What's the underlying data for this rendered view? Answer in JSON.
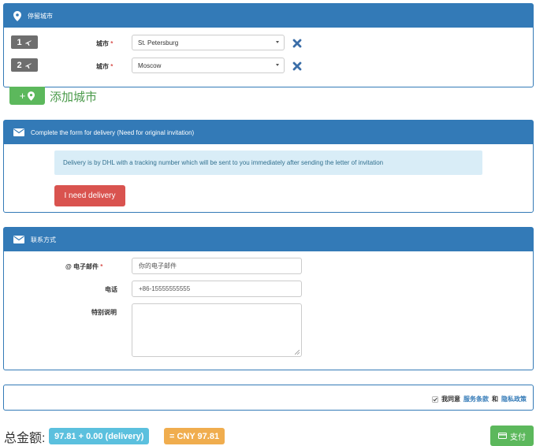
{
  "stay_cities": {
    "heading": "停留城市",
    "rows": [
      {
        "number": "1",
        "label": "城市",
        "required": "*",
        "value": "St. Petersburg"
      },
      {
        "number": "2",
        "label": "城市",
        "required": "*",
        "value": "Moscow"
      }
    ],
    "add_label": "添加城市",
    "add_plus": "+"
  },
  "delivery": {
    "heading": "Complete the form for delivery (Need for original invitation)",
    "info": "Delivery is by DHL with a tracking number which will be sent to you immediately after sending the letter of invitation",
    "button": "I need delivery"
  },
  "contact": {
    "heading": "联系方式",
    "email_label": "电子邮件",
    "email_prefix": "@",
    "email_required": "*",
    "email_placeholder": "你的电子邮件",
    "phone_label": "电话",
    "phone_value": "+86-15555555555",
    "notes_label": "特别说明"
  },
  "agreement": {
    "prefix": "我同意",
    "terms": "服务条款",
    "and": "和",
    "privacy": "隐私政策",
    "checked": true
  },
  "footer": {
    "total_label": "总金额:",
    "amount": "97.81 + 0.00 (delivery)",
    "converted": "= CNY 97.81",
    "pay": "支付"
  },
  "colors": {
    "primary": "#337ab7",
    "success": "#5cb85c",
    "danger": "#d9534f",
    "info": "#5bc0de",
    "warning": "#f0ad4e",
    "remove": "#3b6ea8"
  },
  "icons": [
    "map-marker-icon",
    "plane-icon",
    "remove-icon",
    "envelope-icon",
    "credit-card-icon",
    "checkbox-icon"
  ]
}
